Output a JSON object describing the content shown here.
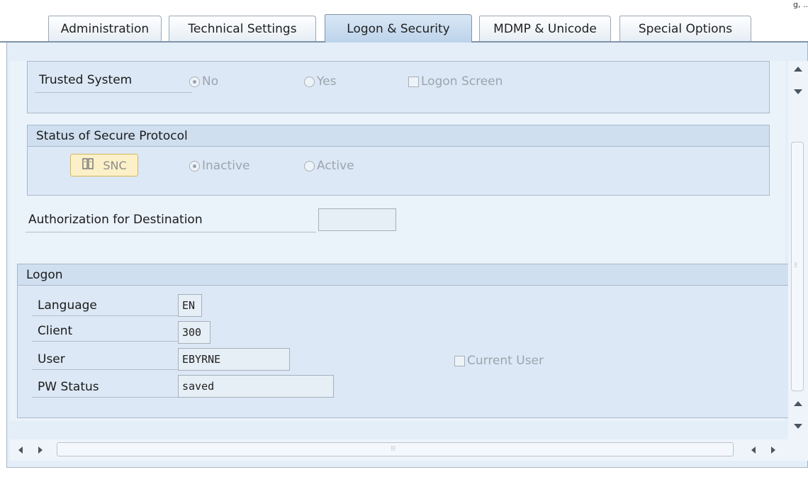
{
  "corner_text": "g, ..",
  "tabs": [
    {
      "label": "Administration"
    },
    {
      "label": "Technical Settings"
    },
    {
      "label": "Logon & Security"
    },
    {
      "label": "MDMP & Unicode"
    },
    {
      "label": "Special Options"
    }
  ],
  "active_tab": "Logon & Security",
  "trusted": {
    "label": "Trusted System",
    "options": [
      "No",
      "Yes"
    ],
    "selected": "No",
    "logon_screen_label": "Logon Screen",
    "logon_screen_checked": false
  },
  "secure_protocol": {
    "title": "Status of Secure Protocol",
    "snc_button_label": "SNC",
    "options": [
      "Inactive",
      "Active"
    ],
    "selected": "Inactive"
  },
  "authorization": {
    "label": "Authorization for Destination",
    "value": ""
  },
  "logon": {
    "title": "Logon",
    "language_label": "Language",
    "language_value": "EN",
    "client_label": "Client",
    "client_value": "300",
    "user_label": "User",
    "user_value": "EBYRNE",
    "current_user_label": "Current User",
    "current_user_checked": false,
    "pw_status_label": "PW Status",
    "pw_status_value": "saved"
  },
  "icons": {
    "snc": "snc-icon",
    "grip": "grip-icon"
  }
}
